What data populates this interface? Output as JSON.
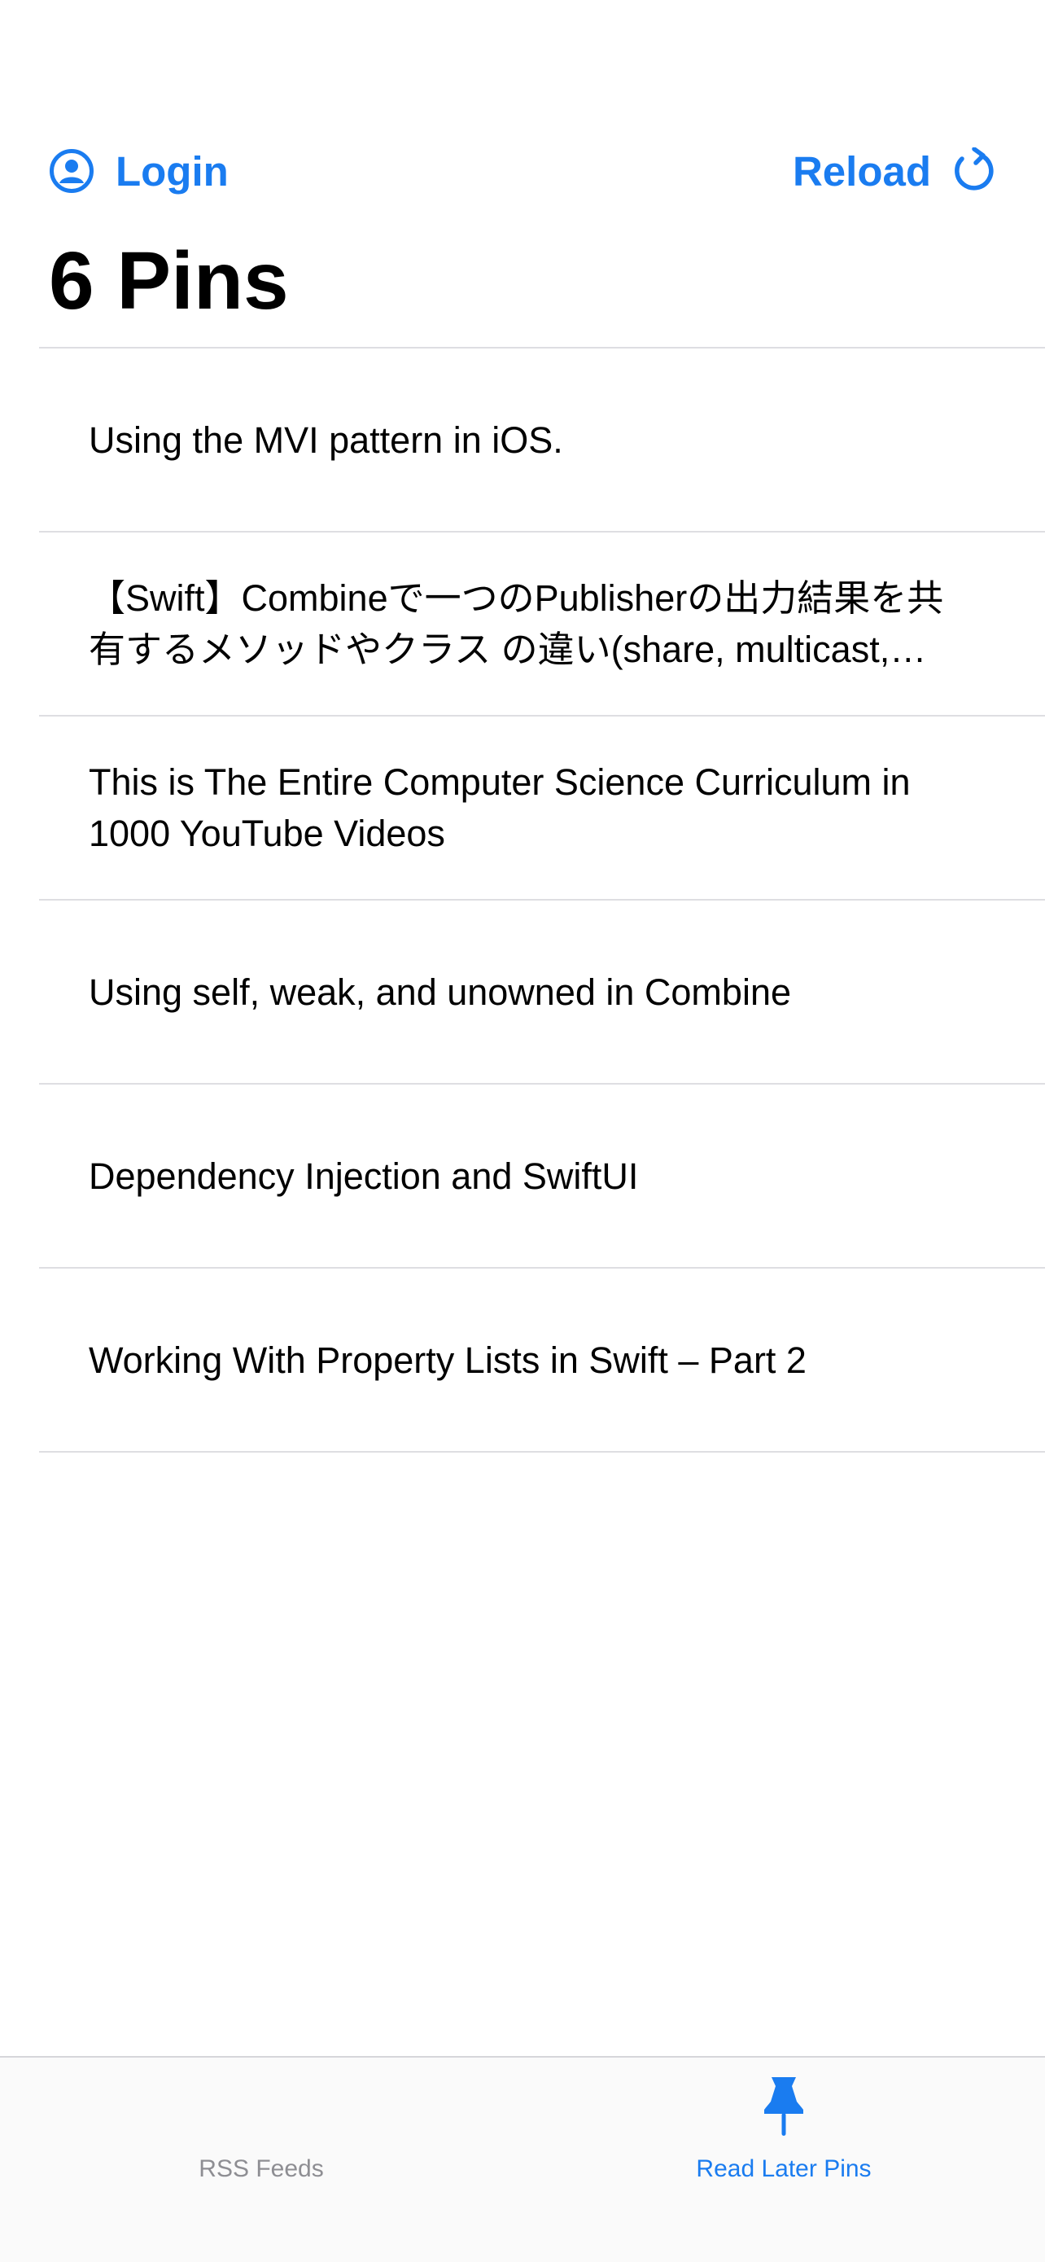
{
  "nav": {
    "login_label": "Login",
    "login_icon": "person-circle-icon",
    "reload_label": "Reload",
    "reload_icon": "arrow-clockwise-icon"
  },
  "page_title": "6 Pins",
  "pins": [
    {
      "title": "Using the MVI pattern in iOS."
    },
    {
      "title": "【Swift】Combineで一つのPublisherの出力結果を共有するメソッドやクラス の違い(share, multicast, Deferred)"
    },
    {
      "title": "This is The Entire Computer Science Curriculum in 1000 YouTube Videos"
    },
    {
      "title": "Using self, weak, and unowned in Combine"
    },
    {
      "title": "Dependency Injection and SwiftUI"
    },
    {
      "title": "Working With Property Lists in Swift – Part 2"
    }
  ],
  "tab_bar": {
    "tabs": [
      {
        "label": "RSS Feeds",
        "selected": false
      },
      {
        "label": "Read Later Pins",
        "icon": "pin-icon",
        "selected": true
      }
    ]
  },
  "colors": {
    "accent": "#1a7cf0",
    "inactive_tab": "#8e8e93",
    "separator": "#dedee2",
    "text": "#000000"
  }
}
